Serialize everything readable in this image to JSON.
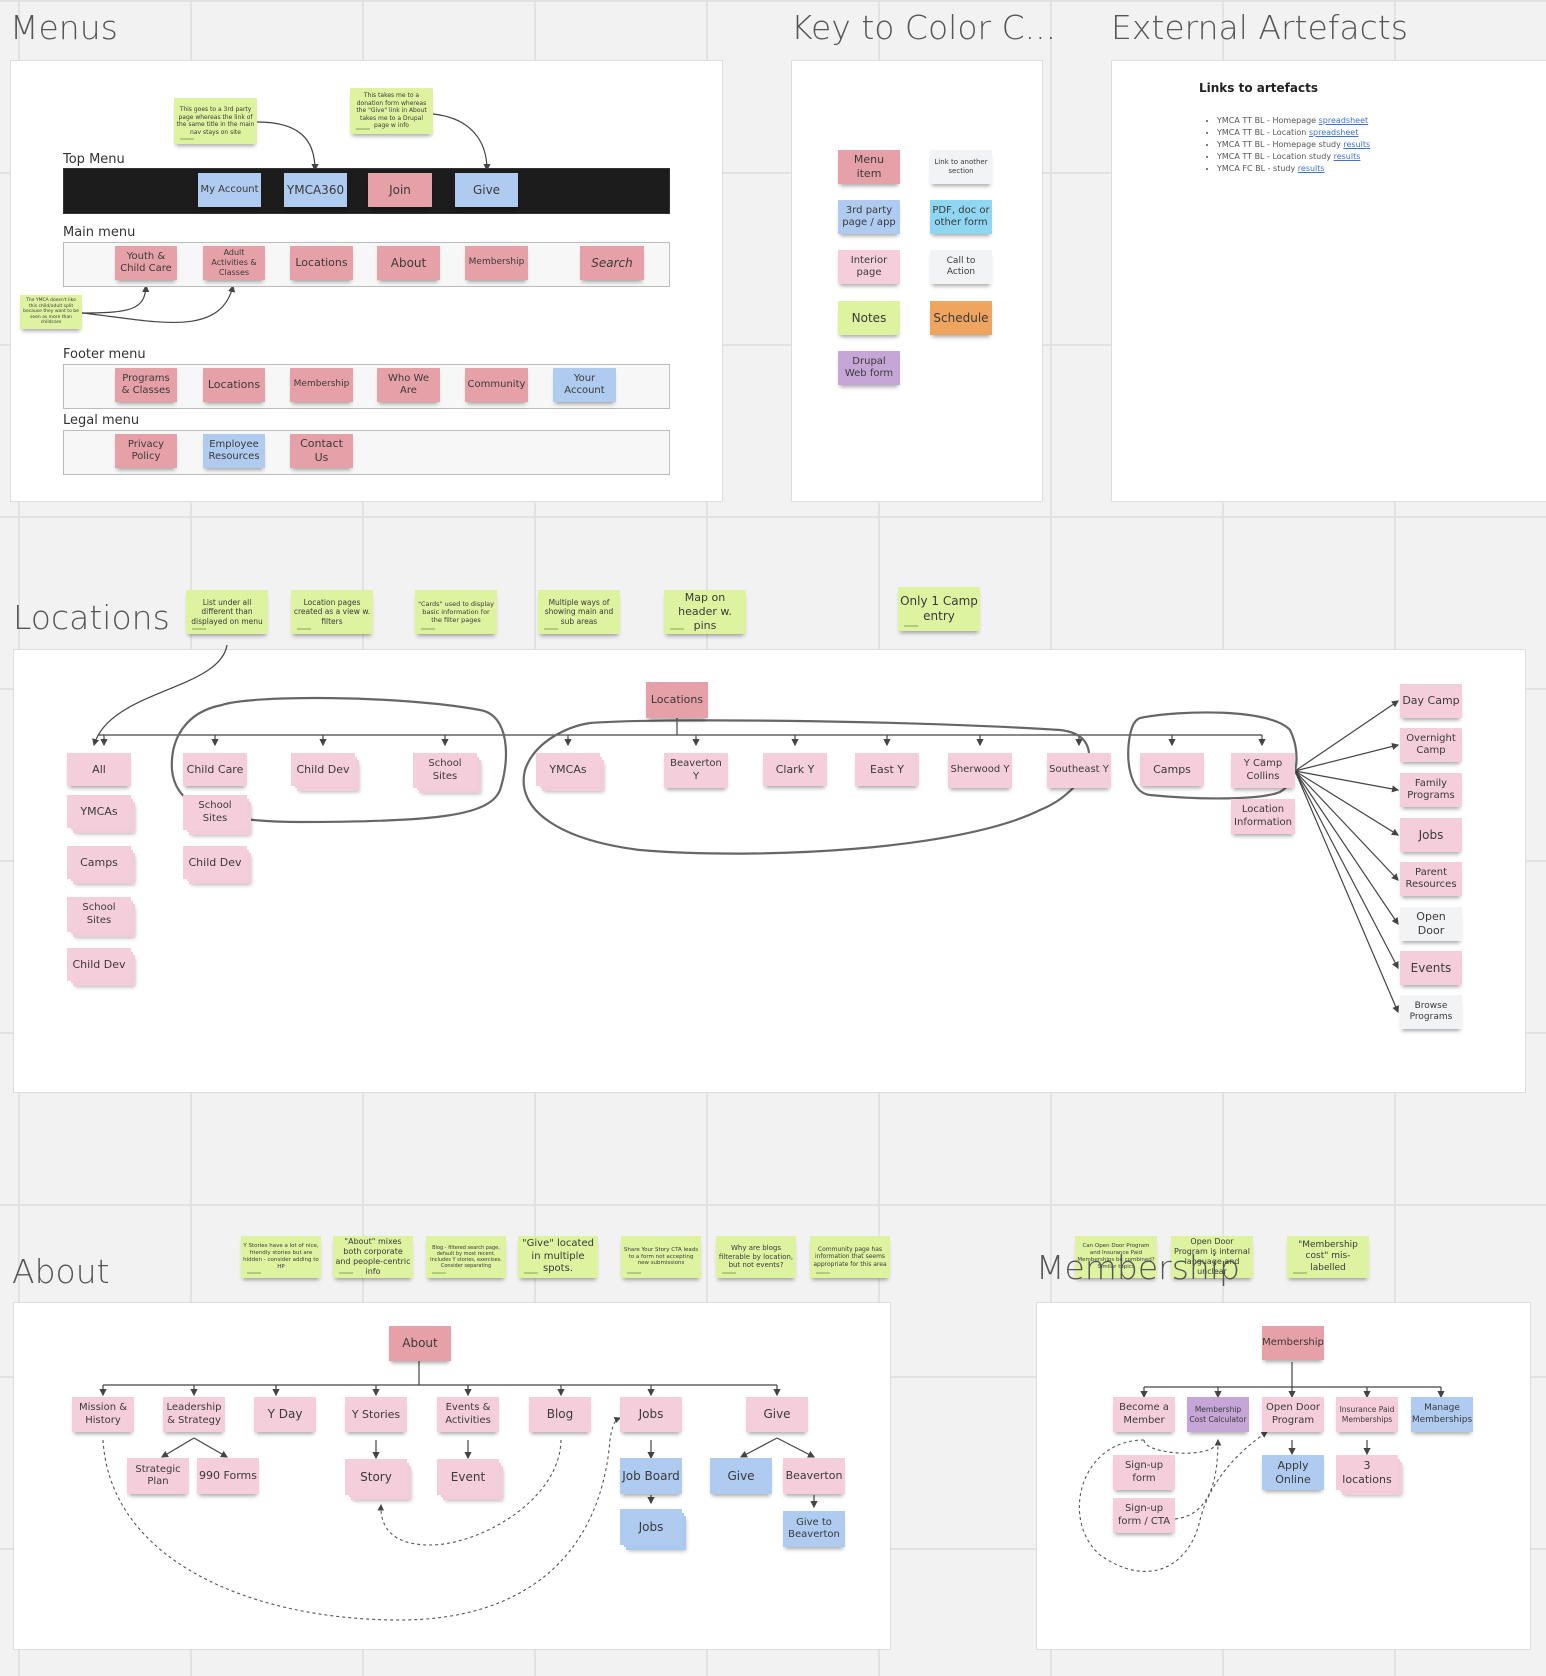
{
  "frames": {
    "menus": "Menus",
    "key": "Key to Color C...",
    "external": "External Artefacts",
    "locations": "Locations",
    "about": "About",
    "membership": "Membership"
  },
  "menus": {
    "notes": {
      "ymca360": "This goes to a 3rd party page whereas the link of the same title in the main nav stays on site",
      "give": "This takes me to a donation form whereas the \"Give\" link in About takes me to a Drupal page w info",
      "split": "The YMCA doesn't like this child/adult split because they want to be seen as more than childcare"
    },
    "top_label": "Top Menu",
    "top": [
      "My Account",
      "YMCA360",
      "Join",
      "Give"
    ],
    "main_label": "Main menu",
    "main": [
      "Youth & Child Care",
      "Adult Activities & Classes",
      "Locations",
      "About",
      "Membership",
      "Search"
    ],
    "footer_label": "Footer menu",
    "footer": [
      "Programs & Classes",
      "Locations",
      "Membership",
      "Who We Are",
      "Community",
      "Your Account"
    ],
    "legal_label": "Legal menu",
    "legal": [
      "Privacy Policy",
      "Employee Resources",
      "Contact Us"
    ]
  },
  "key": {
    "items": [
      "Menu item",
      "Link to another section",
      "3rd party page / app",
      "PDF, doc or other form",
      "Interior page",
      "Call to Action",
      "Notes",
      "Schedule",
      "Drupal Web form"
    ],
    "colors": {
      "menu_item": "#e6a1a8",
      "third_party": "#afcbf0",
      "pdf": "#8fd6f3",
      "interior": "#f5cedb",
      "cta": "#f2f3f5",
      "notes": "#ddf3a0",
      "schedule": "#f0a55f",
      "drupal": "#c6a6d6"
    }
  },
  "external": {
    "title": "Links to artefacts",
    "links": [
      {
        "text": "YMCA TT BL - Homepage ",
        "link": "spreadsheet"
      },
      {
        "text": "YMCA TT BL - Location ",
        "link": "spreadsheet"
      },
      {
        "text": "YMCA TT BL - Homepage study ",
        "link": "results"
      },
      {
        "text": "YMCA TT BL - Location study ",
        "link": "results"
      },
      {
        "text": "YMCA FC BL - study ",
        "link": "results"
      }
    ]
  },
  "locations": {
    "notes": [
      "List under all different than displayed on menu",
      "Location pages created as a view w. filters",
      "\"Cards\" used to display basic information for the filter pages",
      "Multiple ways of showing main and sub areas",
      "Map on header w. pins",
      "Only 1 Camp entry"
    ],
    "root": "Locations",
    "all_col": [
      "All",
      "YMCAs",
      "Camps",
      "School Sites",
      "Child Dev"
    ],
    "childcare_col": [
      "Child Care",
      "School Sites",
      "Child Dev"
    ],
    "level1": [
      "Child Dev",
      "School Sites",
      "YMCAs",
      "Beaverton Y",
      "Clark Y",
      "East Y",
      "Sherwood Y",
      "Southeast Y",
      "Camps",
      "Y Camp Collins"
    ],
    "location_info": "Location Information",
    "camp_children": [
      "Day Camp",
      "Overnight Camp",
      "Family Programs",
      "Jobs",
      "Parent Resources",
      "Open Door",
      "Events",
      "Browse Programs"
    ]
  },
  "about": {
    "notes": [
      "Y Stories have a lot of nice, friendly stories but are hidden - consider adding to HP",
      "\"About\" mixes both corporate and people-centric info",
      "Blog - filtered search page, default by most recent. Includes Y stories, exercises. Consider separating",
      "\"Give\" located in multiple spots.",
      "Share Your Story CTA leads to a form not accepting new submissions",
      "Why are blogs filterable by location, but not events?",
      "Community page has information that seems appropriate for this area"
    ],
    "root": "About",
    "children": [
      "Mission & History",
      "Leadership & Strategy",
      "Y Day",
      "Y Stories",
      "Events & Activities",
      "Blog",
      "Jobs",
      "Give"
    ],
    "sub": [
      "Strategic Plan",
      "990 Forms",
      "Story",
      "Event",
      "Job Board",
      "Jobs",
      "Give",
      "Beaverton",
      "Give to Beaverton"
    ]
  },
  "membership": {
    "notes": [
      "Can Open Door Program and Insurance Paid Memberships be combined? Similar topics",
      "Open Door Program is internal language and unclear",
      "\"Membership cost\" mis-labelled"
    ],
    "root": "Membership",
    "children": [
      "Become a Member",
      "Membership Cost Calculator",
      "Open Door Program",
      "Insurance Paid Memberships",
      "Manage Memberships"
    ],
    "sub": [
      "Sign-up form",
      "Sign-up form / CTA",
      "Apply Online",
      "3 locations"
    ]
  }
}
